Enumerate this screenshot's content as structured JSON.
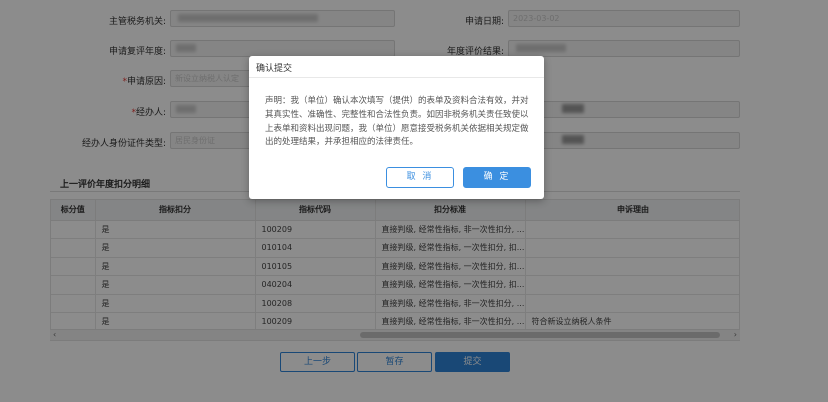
{
  "form": {
    "tax_authority_label": "主管税务机关:",
    "tax_authority_value": "",
    "apply_date_label": "申请日期:",
    "apply_date_value": "2023-03-02",
    "review_year_label": "申请复评年度:",
    "review_year_value": "",
    "eval_result_label": "年度评价结果:",
    "eval_result_value": "",
    "reason_label": "申请原因:",
    "reason_value": "新设立纳税人认定",
    "agent_label": "经办人:",
    "agent_value": "",
    "agent_id_type_label": "经办人身份证件类型:",
    "agent_id_type_value": "居民身份证"
  },
  "section": {
    "title": "上一评价年度扣分明细"
  },
  "table": {
    "headers": [
      "标分值",
      "指标扣分",
      "指标代码",
      "扣分标准",
      "申诉理由"
    ],
    "rows": [
      {
        "deduct": "是",
        "code": "100209",
        "standard": "直接判级, 经常性指标, 非一次性扣分, ...",
        "reason": ""
      },
      {
        "deduct": "是",
        "code": "010104",
        "standard": "直接判级, 经常性指标, 一次性扣分, 扣...",
        "reason": ""
      },
      {
        "deduct": "是",
        "code": "010105",
        "standard": "直接判级, 经常性指标, 一次性扣分, 扣...",
        "reason": ""
      },
      {
        "deduct": "是",
        "code": "040204",
        "standard": "直接判级, 经常性指标, 一次性扣分, 扣...",
        "reason": ""
      },
      {
        "deduct": "是",
        "code": "100208",
        "standard": "直接判级, 经常性指标, 非一次性扣分, ...",
        "reason": ""
      },
      {
        "deduct": "是",
        "code": "100209",
        "standard": "直接判级, 经常性指标, 非一次性扣分, ...",
        "reason": "符合新设立纳税人条件"
      }
    ]
  },
  "scrollbar": {
    "left_arrow": "‹",
    "right_arrow": "›"
  },
  "actions": {
    "prev_label": "上一步",
    "save_label": "暂存",
    "submit_label": "提交"
  },
  "modal": {
    "title": "确认提交",
    "body": "声明：我（单位）确认本次填写（提供）的表单及资料合法有效，并对其真实性、准确性、完整性和合法性负责。如因非税务机关责任致使以上表单和资料出现问题，我（单位）愿意接受税务机关依据相关规定做出的处理结果，并承担相应的法律责任。",
    "cancel_label": "取 消",
    "ok_label": "确 定"
  },
  "colors": {
    "primary": "#2f84d8",
    "required": "#e53935"
  }
}
